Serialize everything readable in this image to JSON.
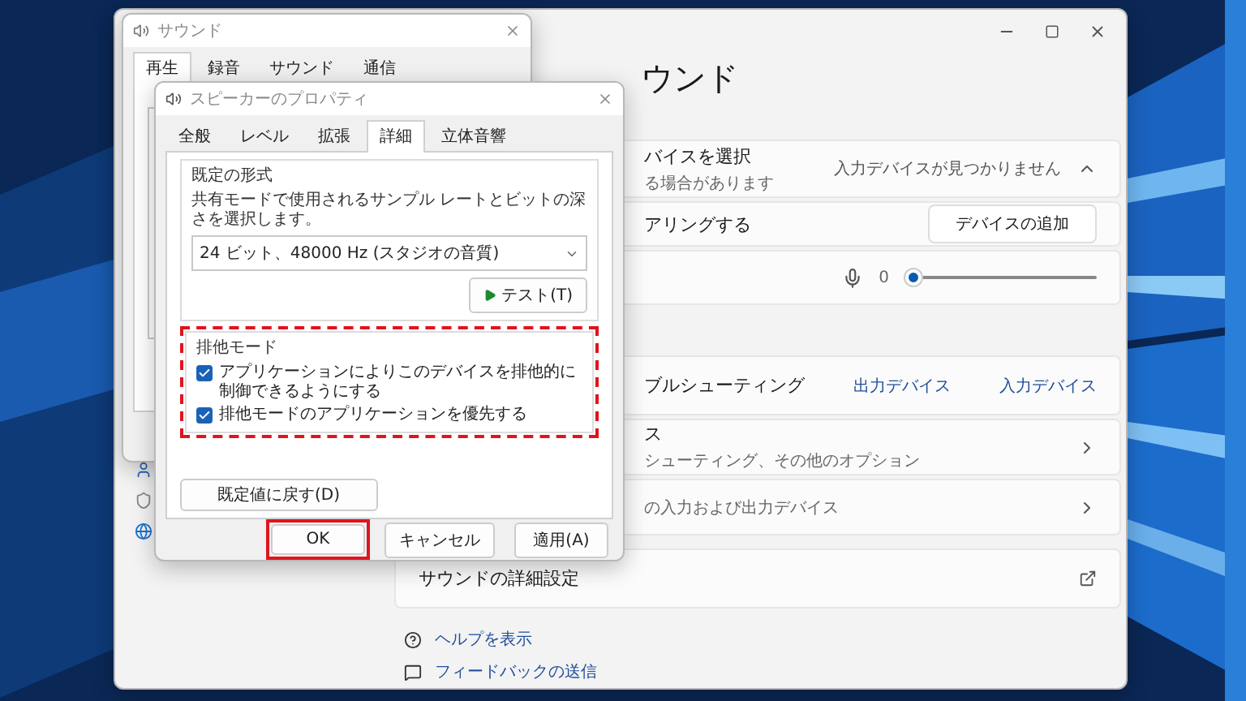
{
  "settings_window": {
    "heading": "ウンド",
    "cards": [
      {
        "kind": "device_select",
        "title": "バイスを選択",
        "subtitle": "る場合があります",
        "status": "入力デバイスが見つかりません",
        "expanded": true
      },
      {
        "kind": "pair",
        "title": "アリングする",
        "button": "デバイスの追加"
      },
      {
        "kind": "volume",
        "reading": "0",
        "level": 0
      },
      {
        "kind": "troubleshoot",
        "title": "ブルシューティング",
        "links": [
          "出力デバイス",
          "入力デバイス"
        ]
      },
      {
        "kind": "nav",
        "title": "ス",
        "subtitle": "シューティング、その他のオプション"
      },
      {
        "kind": "nav",
        "subtitle": "の入力および出力デバイス"
      },
      {
        "kind": "external",
        "title": "サウンドの詳細設定"
      }
    ],
    "help_links": [
      {
        "kind": "help",
        "label": "ヘルプを表示"
      },
      {
        "kind": "feedback",
        "label": "フィードバックの送信"
      }
    ]
  },
  "sound_dialog": {
    "title": "サウンド",
    "tabs": [
      {
        "label": "再生",
        "selected": true
      },
      {
        "label": "録音",
        "selected": false
      },
      {
        "label": "サウンド",
        "selected": false
      },
      {
        "label": "通信",
        "selected": false
      }
    ]
  },
  "properties_dialog": {
    "title": "スピーカーのプロパティ",
    "tabs": [
      {
        "label": "全般",
        "selected": false
      },
      {
        "label": "レベル",
        "selected": false
      },
      {
        "label": "拡張",
        "selected": false
      },
      {
        "label": "詳細",
        "selected": true
      },
      {
        "label": "立体音響",
        "selected": false
      }
    ],
    "format_group": {
      "label": "既定の形式",
      "description": "共有モードで使用されるサンプル レートとビットの深さを選択します。",
      "select_value": "24 ビット、48000 Hz (スタジオの音質)",
      "test_button": "テスト(T)"
    },
    "exclusive_group": {
      "label": "排他モード",
      "highlighted": true,
      "options": [
        {
          "label": "アプリケーションによりこのデバイスを排他的に制御できるようにする",
          "checked": true
        },
        {
          "label": "排他モードのアプリケーションを優先する",
          "checked": true
        }
      ]
    },
    "restore_button": "既定値に戻す(D)",
    "buttons": [
      {
        "label": "OK",
        "highlighted": true
      },
      {
        "label": "キャンセル",
        "highlighted": false
      },
      {
        "label": "適用(A)",
        "highlighted": false
      }
    ]
  }
}
